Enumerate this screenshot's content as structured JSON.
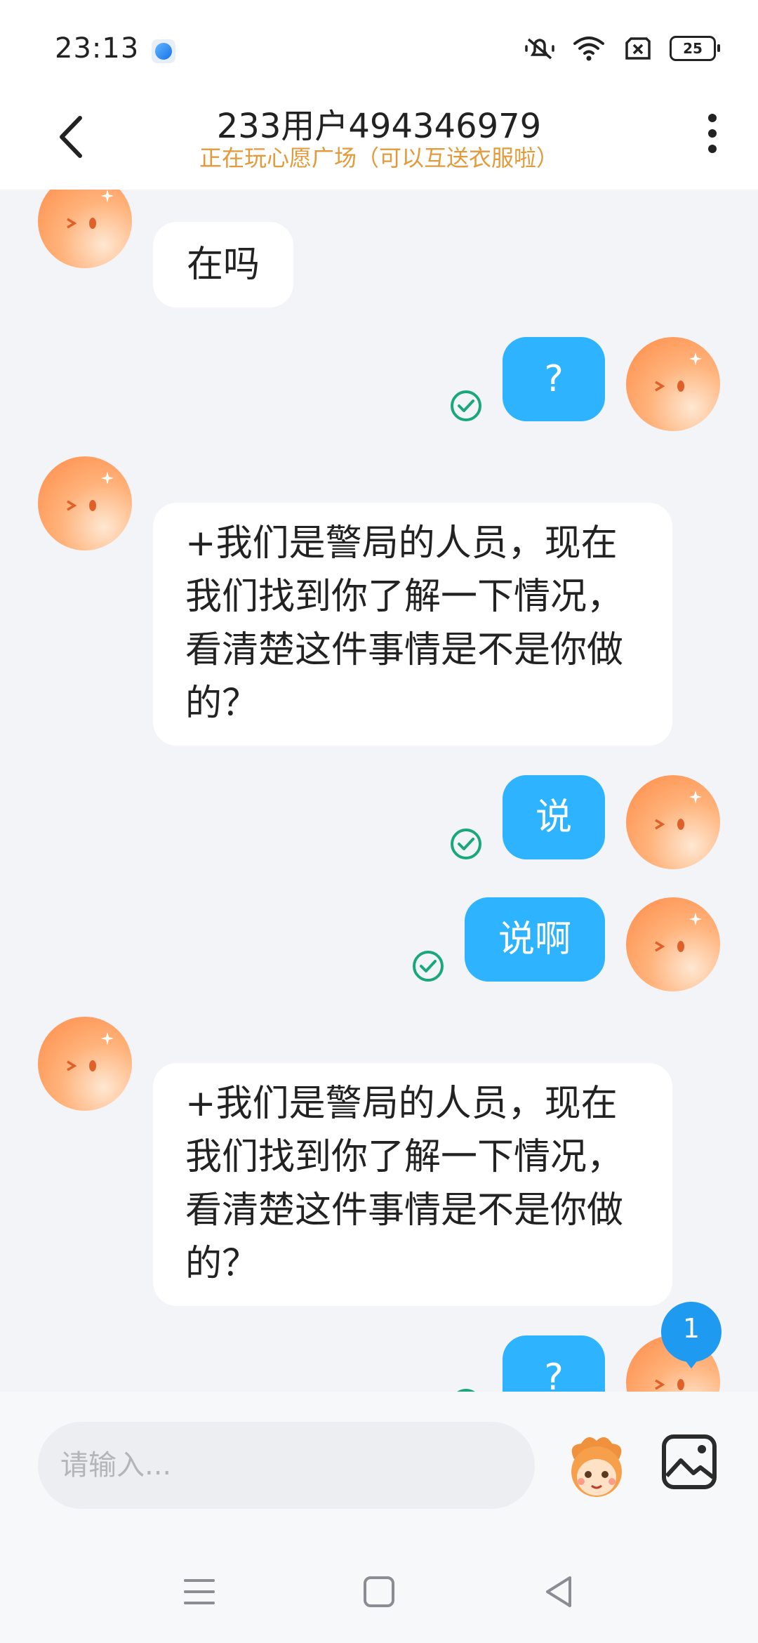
{
  "status": {
    "time": "23:13",
    "battery": "25"
  },
  "header": {
    "title": "233用户494346979",
    "subtitle": "正在玩心愿广场（可以互送衣服啦）"
  },
  "messages": [
    {
      "side": "in",
      "text": "在吗"
    },
    {
      "side": "out",
      "text": "?"
    },
    {
      "side": "in",
      "lines": [
        "+我们是警局的人员，现在",
        "我们找到你了解一下情况，",
        "看清楚这件事情是不是你做",
        "的？"
      ]
    },
    {
      "side": "out",
      "text": "说"
    },
    {
      "side": "out",
      "text": "说啊"
    },
    {
      "side": "in",
      "lines": [
        "+我们是警局的人员，现在",
        "我们找到你了解一下情况，",
        "看清楚这件事情是不是你做",
        "的？"
      ]
    },
    {
      "side": "out",
      "text": "?"
    }
  ],
  "unread_badge": "1",
  "input": {
    "placeholder": "请输入..."
  },
  "colors": {
    "accent": "#2db3ff",
    "subtitle": "#e39a3a",
    "check": "#1aa87a"
  }
}
